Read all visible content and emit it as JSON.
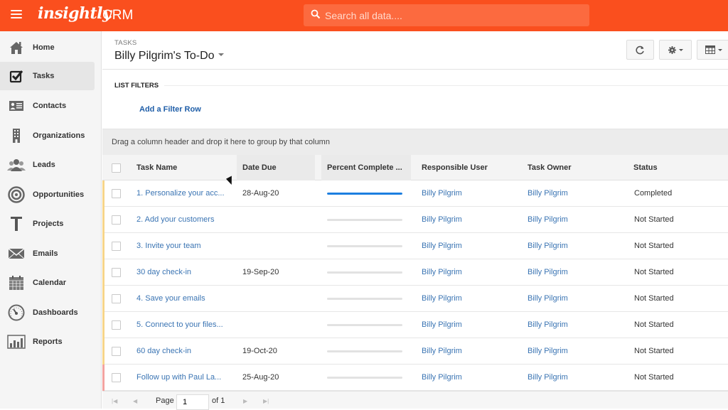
{
  "topbar": {
    "brand": "insightly",
    "product": "CRM",
    "search_placeholder": "Search all data....",
    "brand_color": "#fa4f1e"
  },
  "sidebar": {
    "items": [
      {
        "label": "Home",
        "icon": "home-icon",
        "active": false
      },
      {
        "label": "Tasks",
        "icon": "checkbox-icon",
        "active": true
      },
      {
        "label": "Contacts",
        "icon": "contact-card-icon",
        "active": false
      },
      {
        "label": "Organizations",
        "icon": "building-icon",
        "active": false
      },
      {
        "label": "Leads",
        "icon": "people-icon",
        "active": false
      },
      {
        "label": "Opportunities",
        "icon": "target-icon",
        "active": false
      },
      {
        "label": "Projects",
        "icon": "hammer-icon",
        "active": false
      },
      {
        "label": "Emails",
        "icon": "envelope-icon",
        "active": false
      },
      {
        "label": "Calendar",
        "icon": "calendar-icon",
        "active": false
      },
      {
        "label": "Dashboards",
        "icon": "gauge-icon",
        "active": false
      },
      {
        "label": "Reports",
        "icon": "bar-chart-icon",
        "active": false
      }
    ]
  },
  "header": {
    "breadcrumb": "TASKS",
    "title": "Billy Pilgrim's To-Do",
    "buttons": [
      "refresh-icon",
      "gear-icon",
      "grid-columns-icon"
    ]
  },
  "filters": {
    "label": "LIST FILTERS",
    "add_link": "Add a Filter Row"
  },
  "group_bar": {
    "text": "Drag a column header and drop it here to group by that column"
  },
  "grid": {
    "columns": [
      "Task Name",
      "Date Due",
      "Percent Complete ...",
      "Responsible User",
      "Task Owner",
      "Status"
    ],
    "rows": [
      {
        "task": "1. Personalize your acc...",
        "due": "28-Aug-20",
        "percent": 100,
        "responsible": "Billy Pilgrim",
        "owner": "Billy Pilgrim",
        "status": "Completed",
        "flag_color": "#f7d58a"
      },
      {
        "task": "2. Add your customers",
        "due": "",
        "percent": 0,
        "responsible": "Billy Pilgrim",
        "owner": "Billy Pilgrim",
        "status": "Not Started",
        "flag_color": "#f7d58a"
      },
      {
        "task": "3. Invite your team",
        "due": "",
        "percent": 0,
        "responsible": "Billy Pilgrim",
        "owner": "Billy Pilgrim",
        "status": "Not Started",
        "flag_color": "#f7d58a"
      },
      {
        "task": "30 day check-in",
        "due": "19-Sep-20",
        "percent": 0,
        "responsible": "Billy Pilgrim",
        "owner": "Billy Pilgrim",
        "status": "Not Started",
        "flag_color": "#f7d58a"
      },
      {
        "task": "4. Save your emails",
        "due": "",
        "percent": 0,
        "responsible": "Billy Pilgrim",
        "owner": "Billy Pilgrim",
        "status": "Not Started",
        "flag_color": "#f7d58a"
      },
      {
        "task": "5. Connect to your files...",
        "due": "",
        "percent": 0,
        "responsible": "Billy Pilgrim",
        "owner": "Billy Pilgrim",
        "status": "Not Started",
        "flag_color": "#f7d58a"
      },
      {
        "task": "60 day check-in",
        "due": "19-Oct-20",
        "percent": 0,
        "responsible": "Billy Pilgrim",
        "owner": "Billy Pilgrim",
        "status": "Not Started",
        "flag_color": "#f7d58a"
      },
      {
        "task": "Follow up with Paul La...",
        "due": "25-Aug-20",
        "percent": 0,
        "responsible": "Billy Pilgrim",
        "owner": "Billy Pilgrim",
        "status": "Not Started",
        "flag_color": "#f3a3a0"
      }
    ]
  },
  "pager": {
    "page_label": "Page",
    "page_value": "1",
    "of_label": "of 1"
  }
}
